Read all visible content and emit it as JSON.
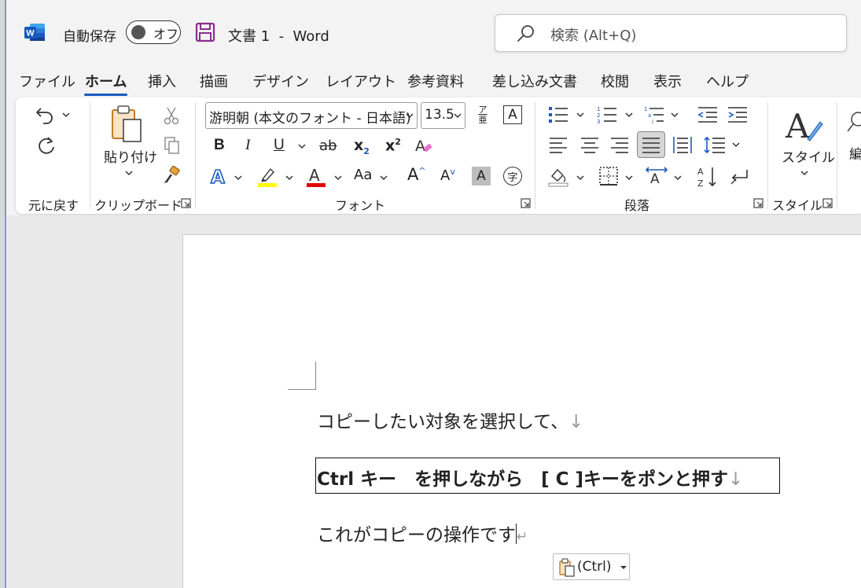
{
  "app": {
    "logo": "word-icon",
    "accent": "#185abd",
    "ribbon_bg": "#ffffff",
    "app_bg": "#f3f3f3"
  },
  "titlebar": {
    "autosave_label": "自動保存",
    "autosave_state": "オフ",
    "doc_title": "文書 1  -  Word",
    "search_placeholder": "検索 (Alt+Q)"
  },
  "tabs": [
    {
      "label": "ファイル"
    },
    {
      "label": "ホーム",
      "active": true
    },
    {
      "label": "挿入"
    },
    {
      "label": "描画"
    },
    {
      "label": "デザイン"
    },
    {
      "label": "レイアウト"
    },
    {
      "label": "参考資料"
    },
    {
      "label": "差し込み文書"
    },
    {
      "label": "校閲"
    },
    {
      "label": "表示"
    },
    {
      "label": "ヘルプ"
    }
  ],
  "ribbon": {
    "undo_group_label": "元に戻す",
    "clipboard": {
      "group_label": "クリップボード",
      "paste_label": "貼り付け"
    },
    "font": {
      "group_label": "フォント",
      "font_name": "游明朝 (本文のフォント - 日本語)",
      "font_size": "13.5",
      "bold": "B",
      "italic": "I",
      "underline": "U",
      "strike": "ab",
      "subscript": "x",
      "subscript_sub": "2",
      "superscript": "x",
      "superscript_sup": "2",
      "change_case": "Aa",
      "grow_font": "A",
      "shrink_font": "A",
      "char_shading": "A",
      "enclose_char": "字",
      "phonetic_top": "ア",
      "phonetic_bottom": "亜",
      "char_border": "A",
      "highlight_color": "#ffff00",
      "font_color": "#e00000"
    },
    "paragraph": {
      "group_label": "段落"
    },
    "styles": {
      "group_label": "スタイル",
      "button_label": "スタイル"
    },
    "editing": {
      "partial_label": "編"
    }
  },
  "document": {
    "para1": "コピーしたい対象を選択して、",
    "para1_mark": "↓",
    "para2_ctrl": "Ctrl",
    "para2_text": " キー　を押しながら　",
    "para2_c": "[ C ]",
    "para2_tail": "キーをポンと押す",
    "para2_mark": "↓",
    "para3": "これがコピーの操作です",
    "para3_mark": "↵",
    "paste_options_label": "(Ctrl)"
  }
}
